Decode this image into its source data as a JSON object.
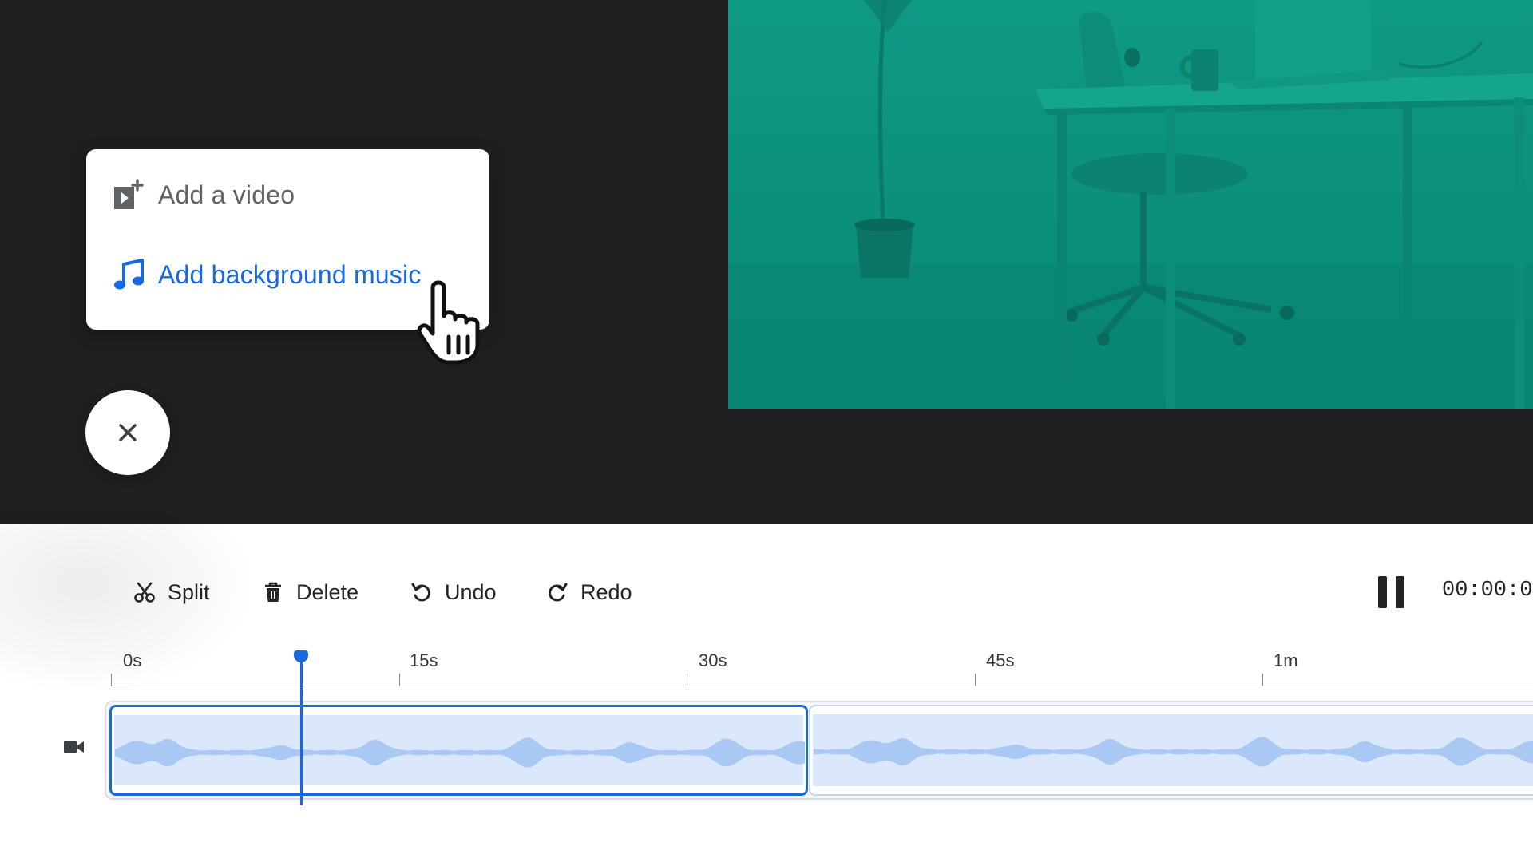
{
  "menu": {
    "items": [
      {
        "label": "Add a video",
        "icon": "video-plus-icon",
        "color": "#5f6368"
      },
      {
        "label": "Add background music",
        "icon": "music-note-icon",
        "color": "#1669e0"
      }
    ]
  },
  "close_button": {
    "icon": "close-icon"
  },
  "toolbar": {
    "split_label": "Split",
    "delete_label": "Delete",
    "undo_label": "Undo",
    "redo_label": "Redo",
    "timecode": "00:00:0"
  },
  "ruler": {
    "ticks": [
      "0s",
      "15s",
      "30s",
      "45s",
      "1m"
    ]
  },
  "timeline": {
    "track_icon": "camera-icon",
    "playhead_label": "playhead"
  },
  "colors": {
    "accent": "#1669e0",
    "stage_bg": "#1f1f22",
    "preview_tint": "#0f9a85",
    "clip_fill": "#dbe8fb",
    "waveform": "#a9c8f4"
  }
}
